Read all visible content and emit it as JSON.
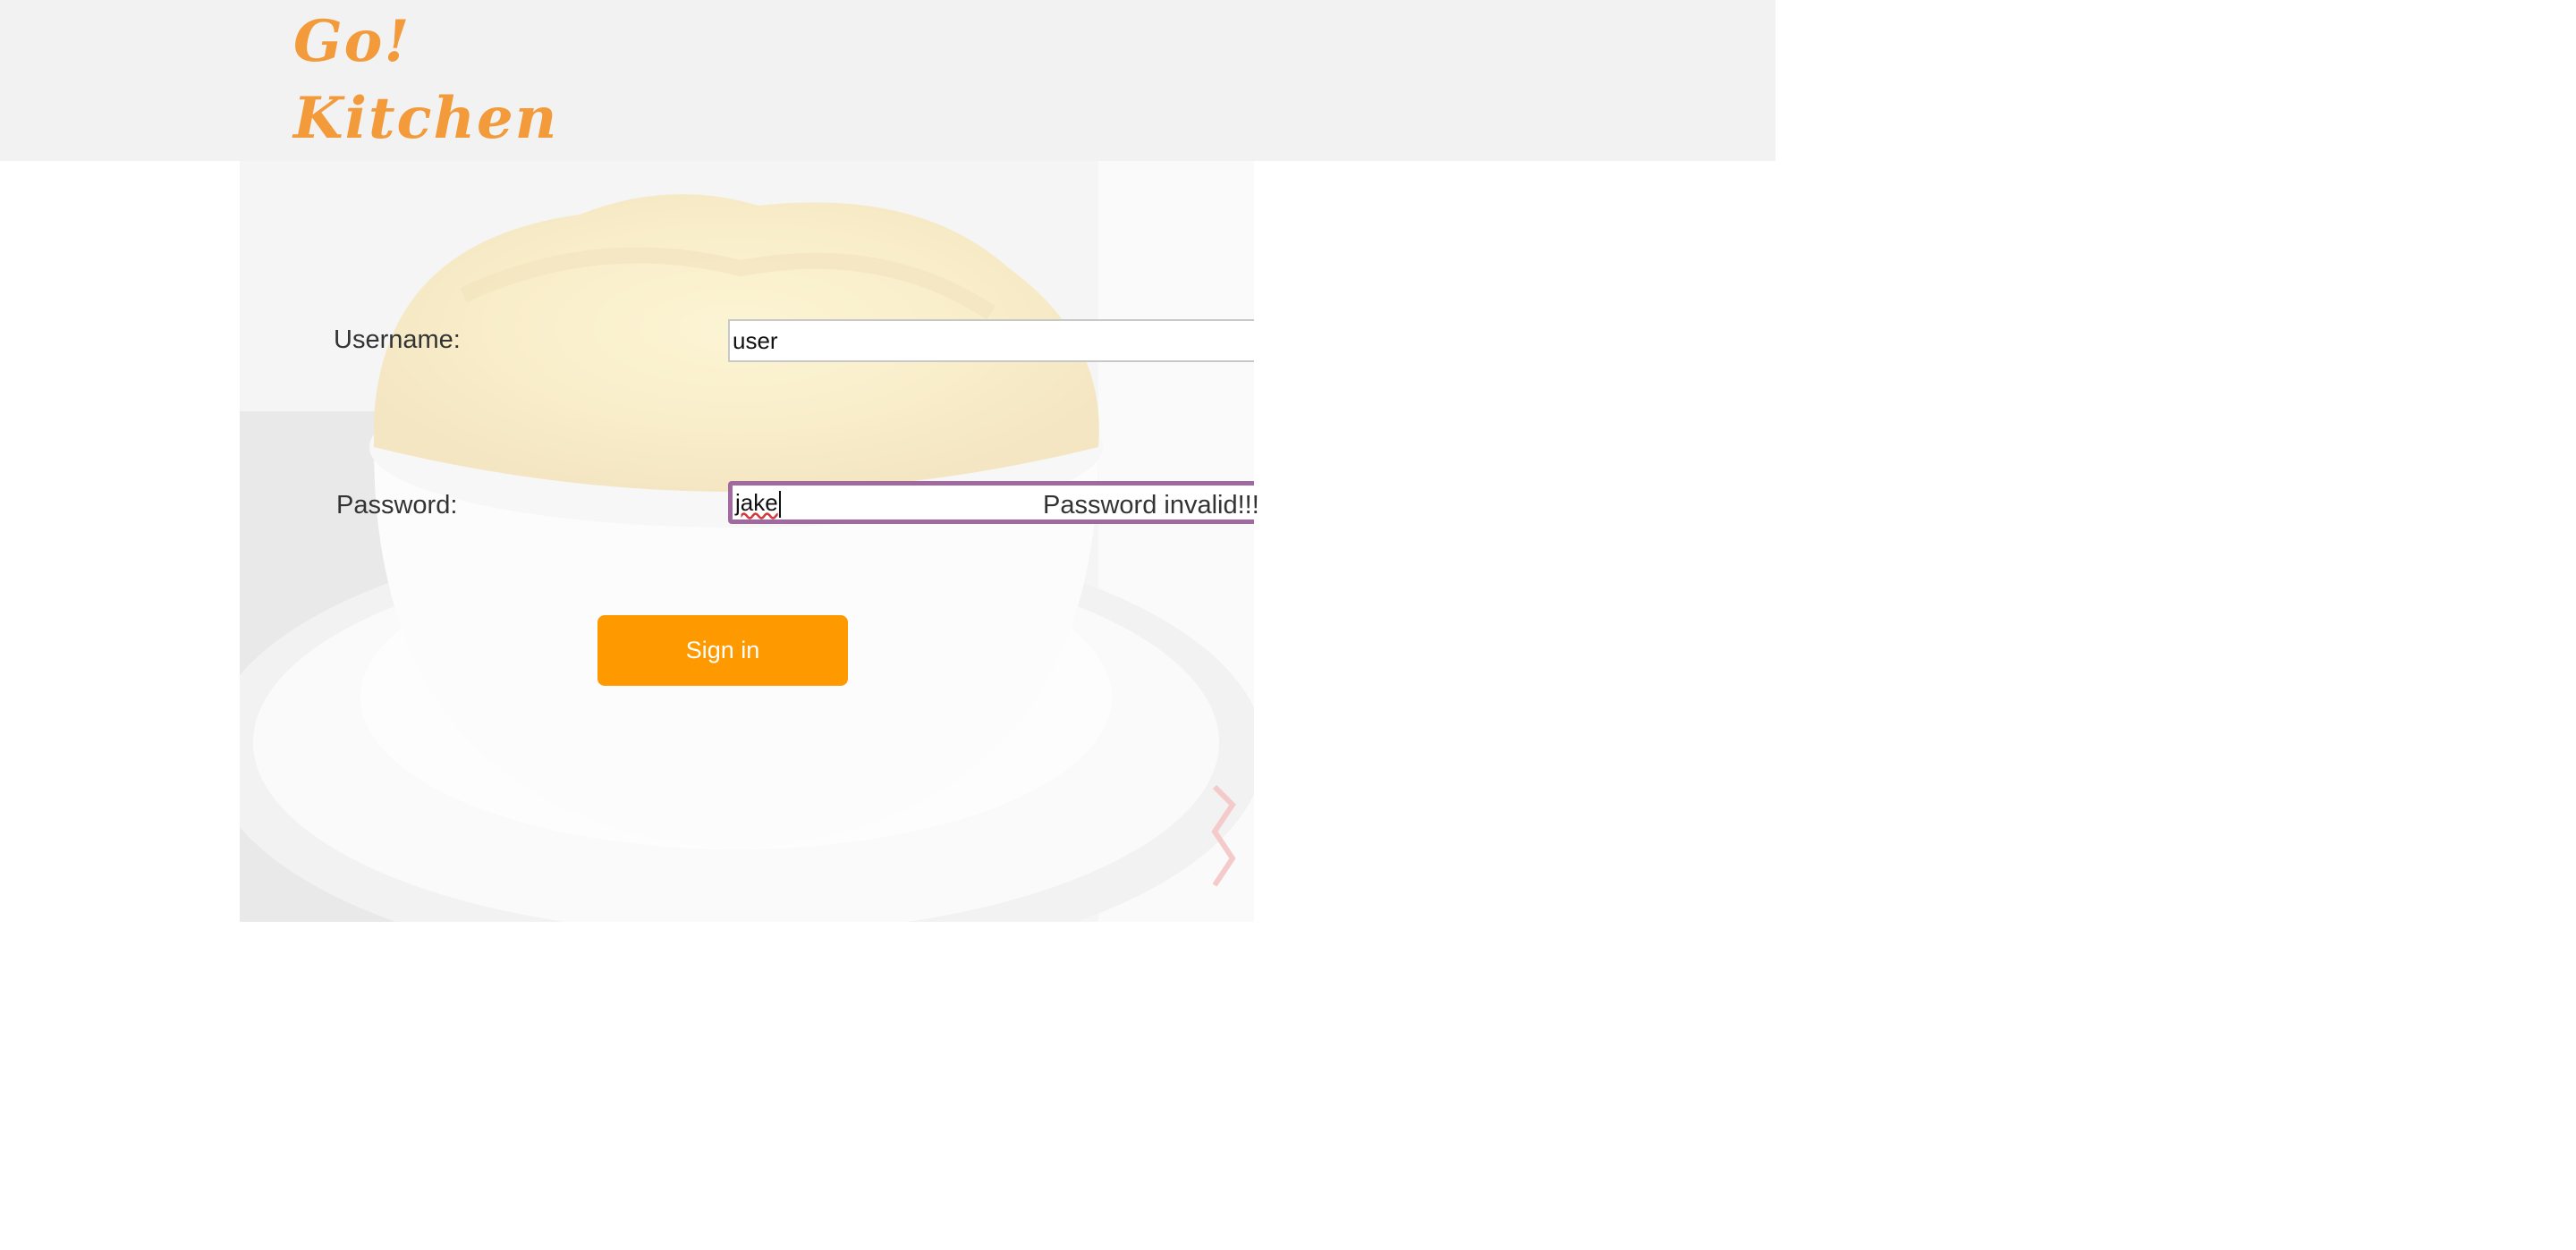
{
  "header": {
    "logo_line1": "Go!",
    "logo_line2": "Kitchen",
    "logo_color": "#f39a3a",
    "background": "#f2f2f2"
  },
  "login_form": {
    "username_label": "Username:",
    "username_value": "user",
    "password_label": "Password:",
    "password_value": "jake",
    "password_error": "Password invalid!!!",
    "signin_label": "Sign in",
    "button_color": "#ff9900",
    "focus_color": "#a06aa0"
  }
}
